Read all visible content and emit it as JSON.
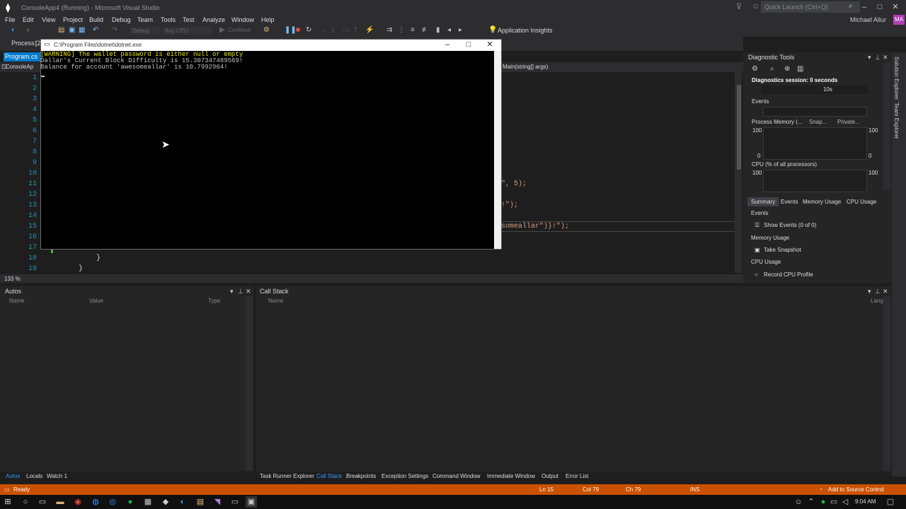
{
  "window": {
    "title": "ConsoleApp4 (Running) - Microsoft Visual Studio",
    "quick_launch_placeholder": "Quick Launch (Ctrl+Q)",
    "user_name": "Michael Allur",
    "user_initials": "MA"
  },
  "menu": [
    "File",
    "Edit",
    "View",
    "Project",
    "Build",
    "Debug",
    "Team",
    "Tools",
    "Test",
    "Analyze",
    "Window",
    "Help"
  ],
  "toolbar": {
    "config": "Debug",
    "platform": "Any CPU",
    "continue_label": "Continue",
    "app_insights": "Application Insights"
  },
  "process_bar": {
    "label": "Process:",
    "value": "[2"
  },
  "tabs": {
    "active": "Program.cs"
  },
  "navbar": {
    "left": "ConsoleAp",
    "right": "Main(string[] args)"
  },
  "editor": {
    "line_numbers": [
      "1",
      "2",
      "3",
      "4",
      "5",
      "6",
      "7",
      "8",
      "9",
      "10",
      "11",
      "12",
      "13",
      "14",
      "15",
      "16",
      "17",
      "18",
      "19"
    ],
    "visible_code": [
      {
        "text": "\", 5);"
      },
      {
        "text": "!\");"
      },
      {
        "text": "someallar\")}!\");"
      },
      {
        "text": "}"
      },
      {
        "text": "}"
      }
    ],
    "zoom": "133 %"
  },
  "console": {
    "title": "C:\\Program Files\\dotnet\\dotnet.exe",
    "lines": [
      {
        "text": "[WARNING] The wallet password is either null or empty",
        "color": "#e5e510"
      },
      {
        "text": "Dallar's Current Block Difficulty is 15.307347489569!",
        "color": "#c0c0c0"
      },
      {
        "text": "Balance for account 'awesomeallar' is 10.7992964!",
        "color": "#c0c0c0"
      }
    ]
  },
  "diagnostics": {
    "title": "Diagnostic Tools",
    "session": "Diagnostics session: 0 seconds",
    "timeline_mark": "10s",
    "events_header": "Events",
    "process_memory": "Process Memory (...",
    "snapshot_legend": "Snap...",
    "private_legend": "Private...",
    "mem_top_left": "100",
    "mem_top_right": "100",
    "mem_bottom_left": "0",
    "mem_bottom_right": "0",
    "cpu_header": "CPU (% of all processors)",
    "cpu_top_left": "100",
    "cpu_top_right": "100",
    "tabs": [
      "Summary",
      "Events",
      "Memory Usage",
      "CPU Usage"
    ],
    "events_section": "Events",
    "show_events": "Show Events (0 of 0)",
    "memory_section": "Memory Usage",
    "take_snapshot": "Take Snapshot",
    "cpu_section": "CPU Usage",
    "record_cpu": "Record CPU Profile"
  },
  "right_rail": [
    "Solution Explorer",
    "Team Explorer"
  ],
  "autos": {
    "title": "Autos",
    "columns": [
      "Name",
      "Value",
      "Type"
    ]
  },
  "callstack": {
    "title": "Call Stack",
    "columns": [
      "Name",
      "Lang"
    ]
  },
  "bottom_tabs_left": [
    "Autos",
    "Locals",
    "Watch 1"
  ],
  "bottom_tabs_right": [
    "Task Runner Explorer",
    "Call Stack",
    "Breakpoints",
    "Exception Settings",
    "Command Window",
    "Immediate Window",
    "Output",
    "Error List"
  ],
  "status": {
    "ready": "Ready",
    "ln": "Ln 15",
    "col": "Col 79",
    "ch": "Ch 79",
    "ins": "INS",
    "source_control": "Add to Source Control"
  },
  "taskbar": {
    "time": "9:04 AM"
  }
}
